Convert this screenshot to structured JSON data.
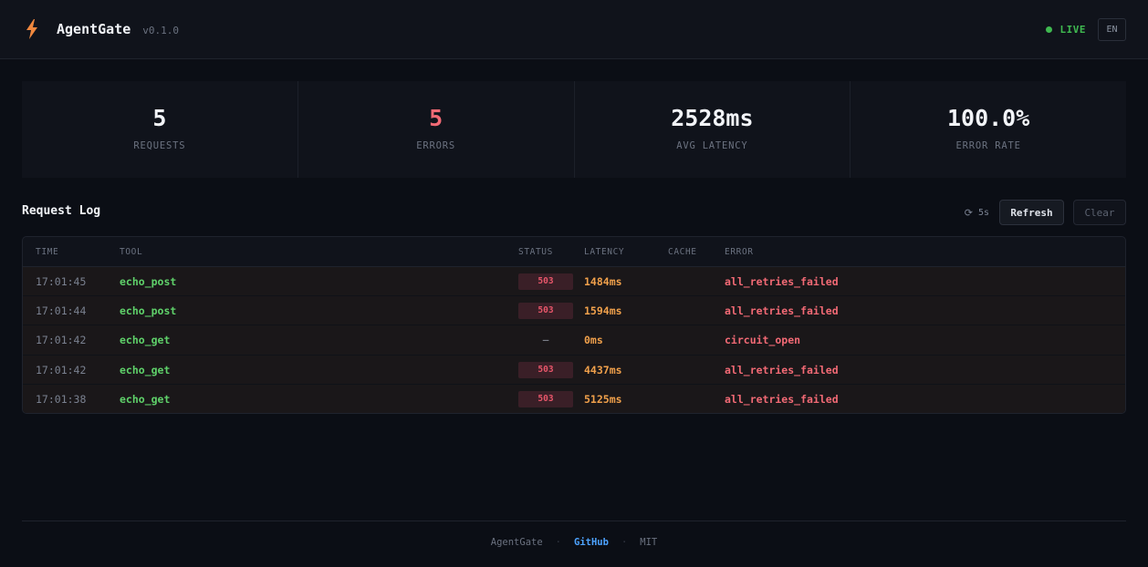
{
  "header": {
    "app_name": "AgentGate",
    "version": "v0.1.0",
    "live_label": "LIVE",
    "language": "EN",
    "accent_color": "#f0883e",
    "live_color": "#3fb950"
  },
  "stats": [
    {
      "value": "5",
      "label": "REQUESTS"
    },
    {
      "value": "5",
      "label": "ERRORS"
    },
    {
      "value": "2528ms",
      "label": "AVG LATENCY"
    },
    {
      "value": "100.0%",
      "label": "ERROR RATE"
    }
  ],
  "log": {
    "title": "Request Log",
    "interval": "5s",
    "refresh_label": "Refresh",
    "clear_label": "Clear",
    "columns": [
      "TIME",
      "TOOL",
      "STATUS",
      "LATENCY",
      "CACHE",
      "ERROR"
    ],
    "rows": [
      {
        "time": "17:01:45",
        "tool": "echo_post",
        "status": "503",
        "latency": "1484ms",
        "cache": "",
        "error": "all_retries_failed"
      },
      {
        "time": "17:01:44",
        "tool": "echo_post",
        "status": "503",
        "latency": "1594ms",
        "cache": "",
        "error": "all_retries_failed"
      },
      {
        "time": "17:01:42",
        "tool": "echo_get",
        "status": "–",
        "latency": "0ms",
        "cache": "",
        "error": "circuit_open"
      },
      {
        "time": "17:01:42",
        "tool": "echo_get",
        "status": "503",
        "latency": "4437ms",
        "cache": "",
        "error": "all_retries_failed"
      },
      {
        "time": "17:01:38",
        "tool": "echo_get",
        "status": "503",
        "latency": "5125ms",
        "cache": "",
        "error": "all_retries_failed"
      }
    ]
  },
  "footer": {
    "brand": "AgentGate",
    "separator": "·",
    "link": "GitHub",
    "license": "MIT"
  }
}
